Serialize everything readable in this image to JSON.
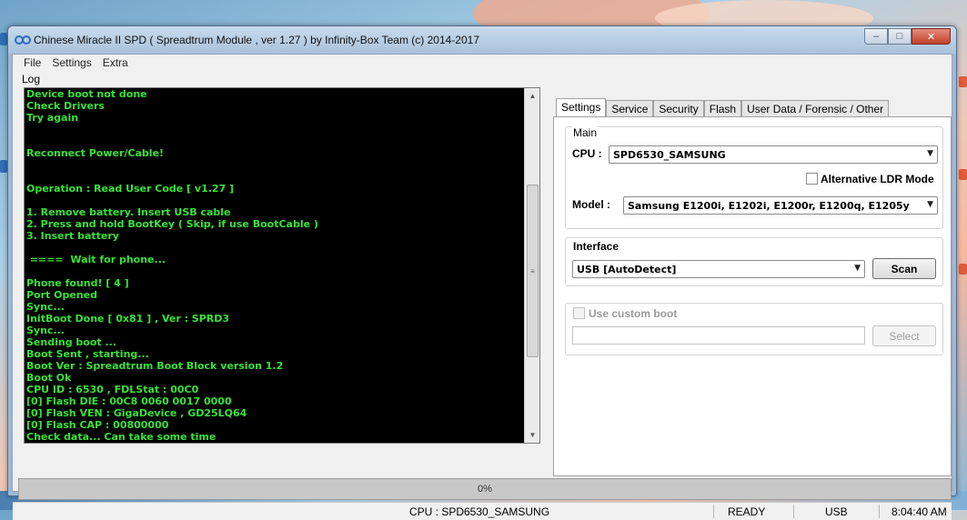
{
  "window": {
    "title": "Chinese Miracle II SPD ( Spreadtrum Module , ver 1.27 ) by Infinity-Box Team (c) 2014-2017",
    "controls": {
      "minimize": "–",
      "maximize": "□",
      "close": "✕"
    }
  },
  "menu": [
    "File",
    "Settings",
    "Extra"
  ],
  "log": {
    "label": "Log",
    "lines": [
      "Device boot not done",
      "Check Drivers",
      "Try again",
      "",
      "",
      "Reconnect Power/Cable!",
      "",
      "",
      "Operation : Read User Code [ v1.27 ]",
      "",
      "1. Remove battery. Insert USB cable",
      "2. Press and hold BootKey ( Skip, if use BootCable )",
      "3. Insert battery",
      "",
      " ====  Wait for phone...",
      "",
      "Phone found! [ 4 ]",
      "Port Opened",
      "Sync...",
      "InitBoot Done [ 0x81 ] , Ver : SPRD3",
      "Sync...",
      "Sending boot ...",
      "Boot Sent , starting...",
      "Boot Ver : Spreadtrum Boot Block version 1.2",
      "Boot Ok",
      "CPU ID : 6530 , FDLStat : 00C0",
      "[0] Flash DIE : 00C8 0060 0017 0000",
      "[0] Flash VEN : GigaDevice , GD25LQ64",
      "[0] Flash CAP : 00800000",
      "Check data... Can take some time"
    ]
  },
  "tabs": [
    "Settings",
    "Service",
    "Security",
    "Flash",
    "User Data / Forensic / Other"
  ],
  "settings": {
    "main_group": "Main",
    "cpu_label": "CPU :",
    "cpu_value": "SPD6530_SAMSUNG",
    "alt_ldr_label": "Alternative LDR Mode",
    "model_label": "Model :",
    "model_value": "Samsung E1200i, E1202i, E1200r, E1200q, E1205y",
    "interface_group": "Interface",
    "interface_value": "USB [AutoDetect]",
    "scan_label": "Scan",
    "custom_boot_label": "Use custom boot",
    "select_label": "Select"
  },
  "progress": {
    "text": "0%",
    "value": 0
  },
  "status": {
    "cpu": "CPU : SPD6530_SAMSUNG",
    "state": "READY",
    "port": "USB",
    "time": "8:04:40 AM"
  },
  "colors": {
    "log_bg": "#000000",
    "log_text": "#37e237",
    "title_bar": "#b8cde2"
  }
}
